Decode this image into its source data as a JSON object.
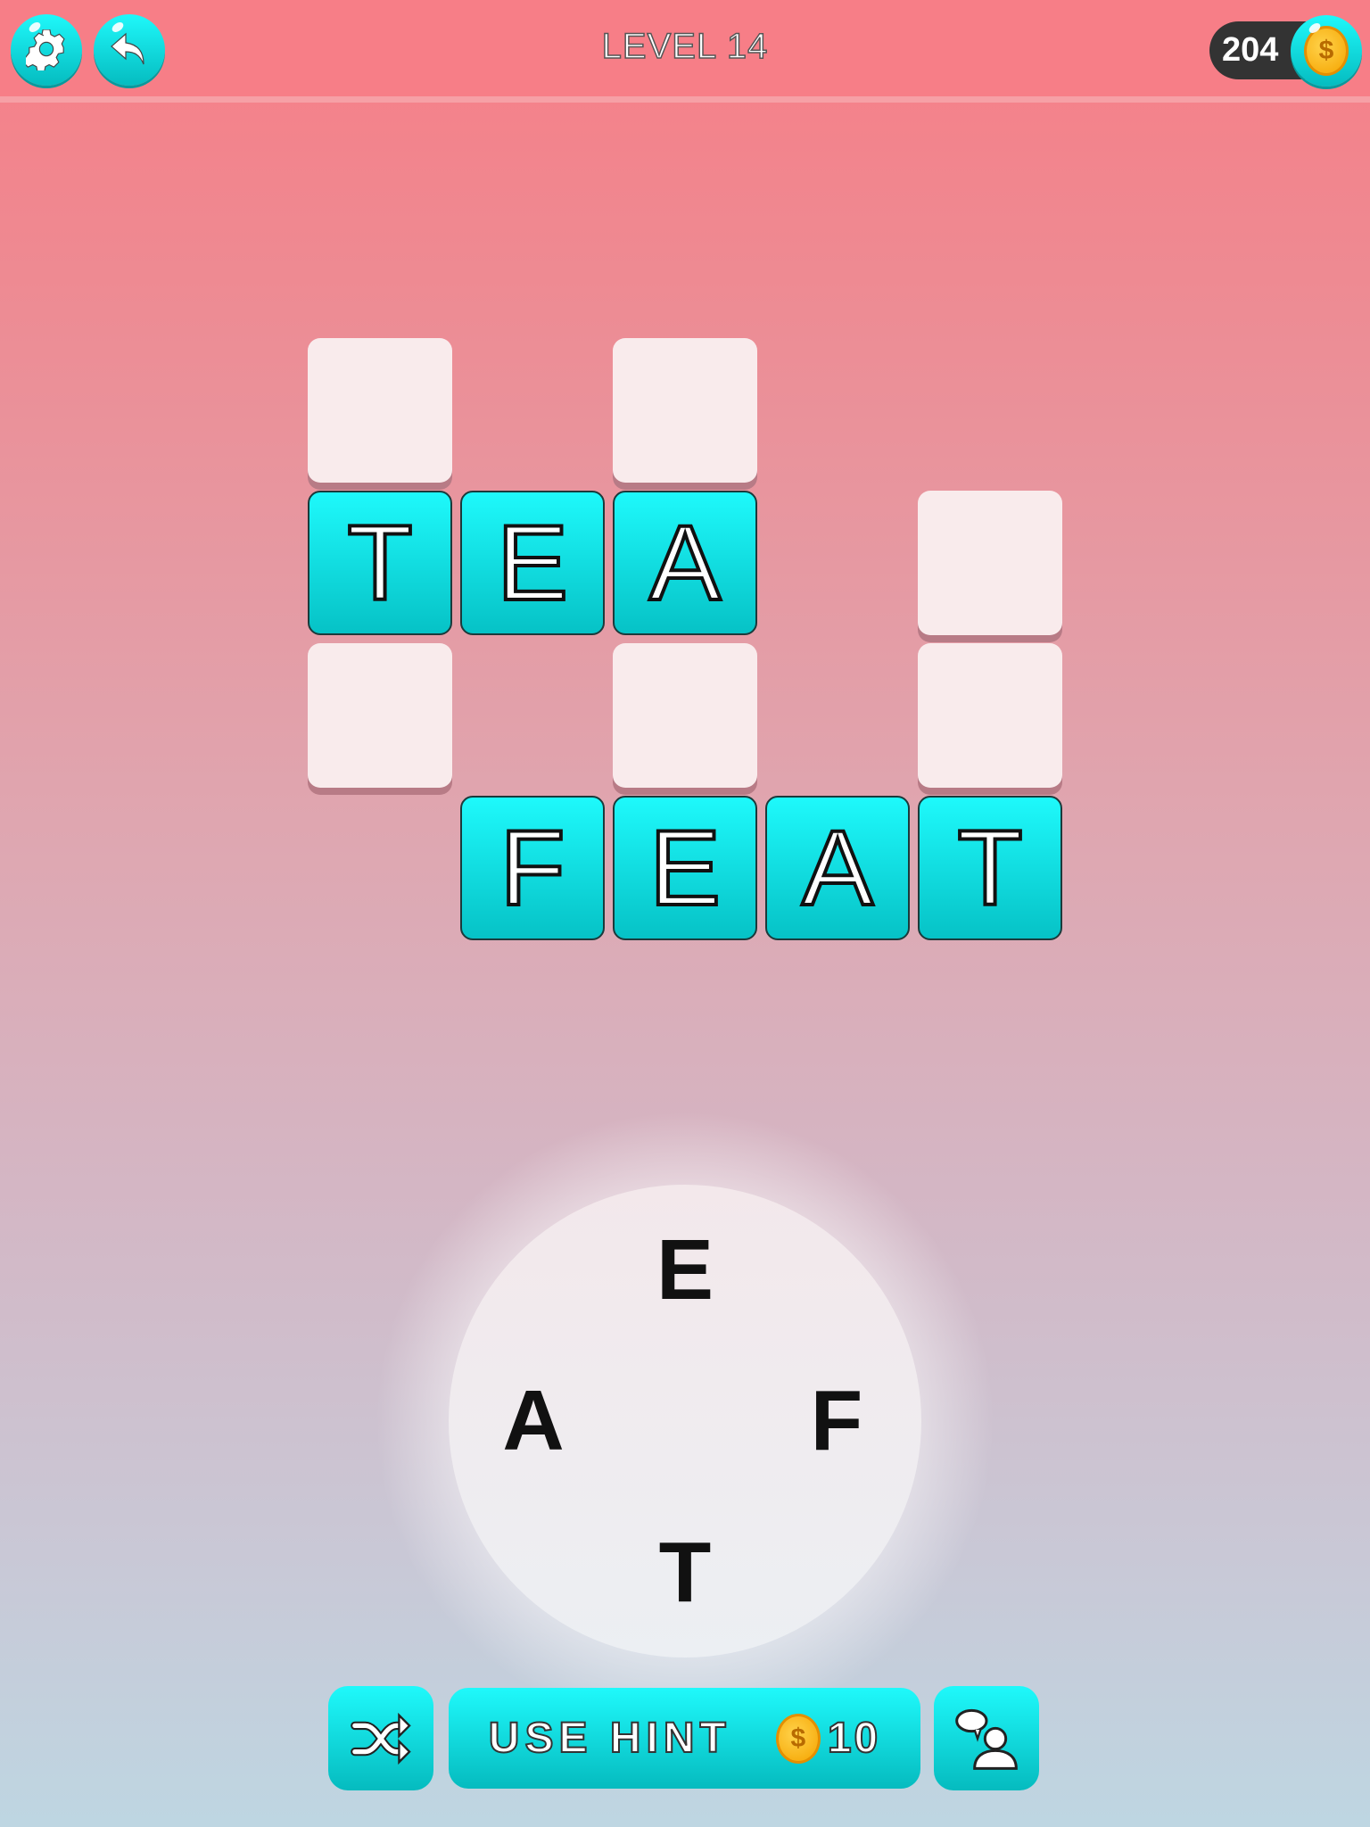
{
  "header": {
    "title": "LEVEL 14",
    "coins": "204",
    "settings_icon": "gear-icon",
    "back_icon": "back-arrow-icon",
    "coin_icon": "coin-icon"
  },
  "grid": {
    "tiles": [
      {
        "row": 0,
        "col": 0,
        "letter": ""
      },
      {
        "row": 0,
        "col": 2,
        "letter": ""
      },
      {
        "row": 1,
        "col": 0,
        "letter": "T"
      },
      {
        "row": 1,
        "col": 1,
        "letter": "E"
      },
      {
        "row": 1,
        "col": 2,
        "letter": "A"
      },
      {
        "row": 1,
        "col": 4,
        "letter": ""
      },
      {
        "row": 2,
        "col": 0,
        "letter": ""
      },
      {
        "row": 2,
        "col": 2,
        "letter": ""
      },
      {
        "row": 2,
        "col": 4,
        "letter": ""
      },
      {
        "row": 3,
        "col": 1,
        "letter": "F"
      },
      {
        "row": 3,
        "col": 2,
        "letter": "E"
      },
      {
        "row": 3,
        "col": 3,
        "letter": "A"
      },
      {
        "row": 3,
        "col": 4,
        "letter": "T"
      }
    ],
    "found_words": [
      "TEA",
      "FEAT"
    ]
  },
  "wheel": {
    "letters": [
      "E",
      "F",
      "T",
      "A"
    ]
  },
  "footer": {
    "shuffle_icon": "shuffle-icon",
    "hint_label": "USE HINT",
    "hint_cost": "10",
    "share_icon": "ask-friend-icon"
  },
  "colors": {
    "accent": "#10e6ea",
    "header": "#f77e87",
    "empty_tile": "#f9ebec"
  }
}
